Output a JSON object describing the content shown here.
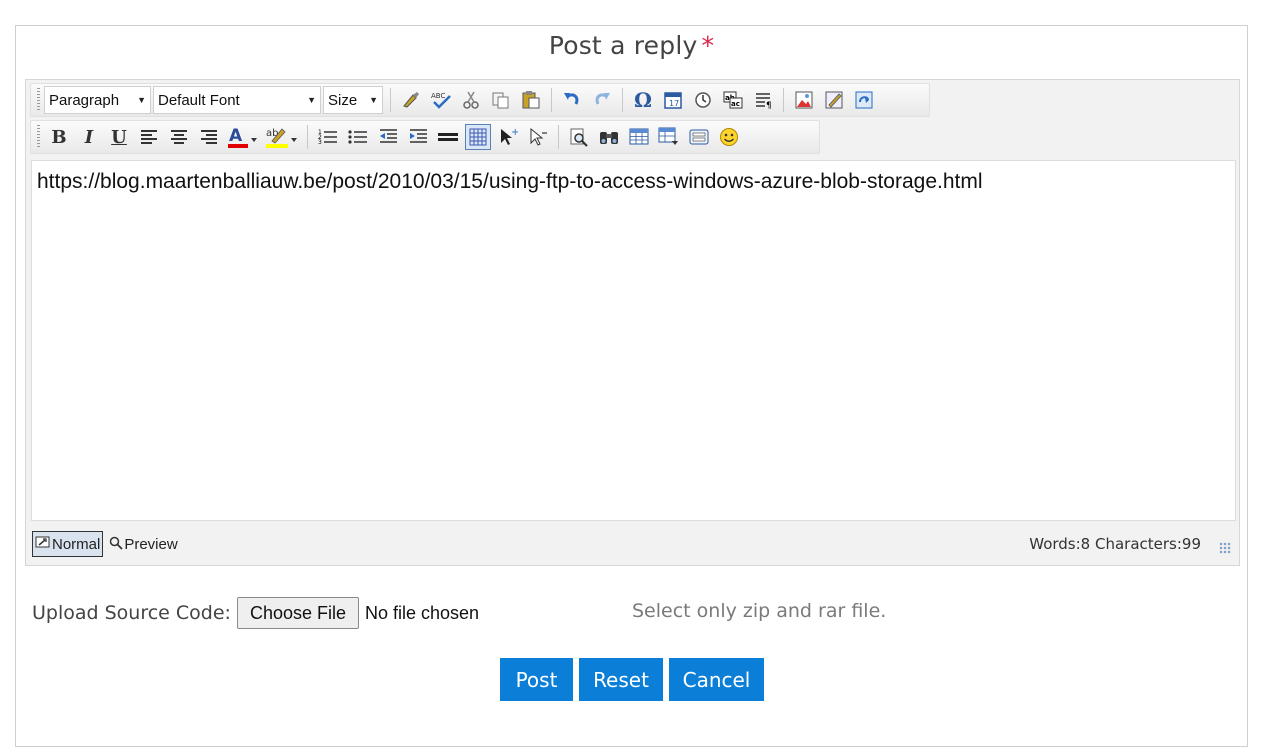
{
  "form": {
    "title": "Post a reply",
    "required_mark": "*"
  },
  "editor": {
    "toolbar": {
      "paragraph_select": "Paragraph",
      "font_select": "Default Font",
      "size_select": "Size",
      "icons_row1": [
        "format-painter-icon",
        "spellcheck-icon",
        "cut-icon",
        "copy-icon",
        "paste-icon",
        "undo-icon",
        "redo-icon",
        "special-char-icon",
        "insert-date-icon",
        "insert-time-icon",
        "find-replace-icon",
        "paragraph-icon",
        "insert-image-icon",
        "edit-image-icon",
        "insert-flash-icon"
      ],
      "icons_row2": [
        "bold-icon",
        "italic-icon",
        "underline-icon",
        "align-left-icon",
        "align-center-icon",
        "align-right-icon",
        "font-color-icon",
        "highlight-color-icon",
        "ordered-list-icon",
        "unordered-list-icon",
        "outdent-icon",
        "indent-icon",
        "horizontal-rule-icon",
        "table-icon",
        "select-all-icon",
        "select-icon",
        "find-icon",
        "binoculars-icon",
        "insert-table-icon",
        "table-props-icon",
        "form-icon",
        "smiley-icon"
      ],
      "bold_label": "B",
      "italic_label": "I",
      "underline_label": "U",
      "omega_label": "Ω",
      "font_color_label": "A",
      "highlight_label": "ab"
    },
    "content": "https://blog.maartenballiauw.be/post/2010/03/15/using-ftp-to-access-windows-azure-blob-storage.html",
    "modes": {
      "normal": "Normal",
      "preview": "Preview"
    },
    "counts": "Words:8 Characters:99"
  },
  "upload": {
    "label": "Upload Source Code:",
    "button": "Choose File",
    "status": "No file chosen",
    "hint": "Select only zip and rar file."
  },
  "actions": {
    "post": "Post",
    "reset": "Reset",
    "cancel": "Cancel"
  },
  "colors": {
    "primary_button": "#0b7fd8",
    "required_mark": "#d9254a",
    "font_color_bar": "#e00000",
    "highlight_bar": "#ffff00"
  }
}
